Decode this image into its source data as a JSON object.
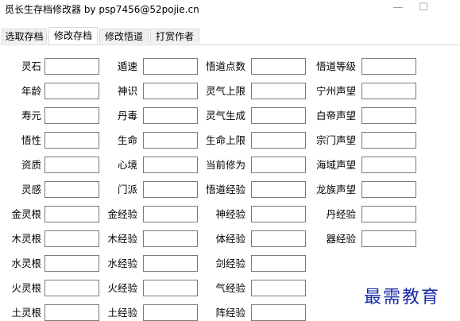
{
  "window": {
    "title": "觅长生存档修改器 by psp7456@52pojie.cn"
  },
  "tabs": [
    "选取存档",
    "修改存档",
    "修改悟道",
    "打赏作者"
  ],
  "form": {
    "col1": [
      "灵石",
      "年龄",
      "寿元",
      "悟性",
      "资质",
      "灵感",
      "金灵根",
      "木灵根",
      "水灵根",
      "火灵根",
      "土灵根"
    ],
    "col2": [
      "遁速",
      "神识",
      "丹毒",
      "生命",
      "心境",
      "门派",
      "金经验",
      "木经验",
      "水经验",
      "火经验",
      "土经验"
    ],
    "col3": [
      "悟道点数",
      "灵气上限",
      "灵气生成",
      "生命上限",
      "当前修为",
      "悟道经验",
      "神经验",
      "体经验",
      "剑经验",
      "气经验",
      "阵经验"
    ],
    "col4": [
      "悟道等级",
      "宁州声望",
      "白帝声望",
      "宗门声望",
      "海域声望",
      "龙族声望",
      "丹经验",
      "器经验"
    ]
  },
  "watermark": "最需教育"
}
